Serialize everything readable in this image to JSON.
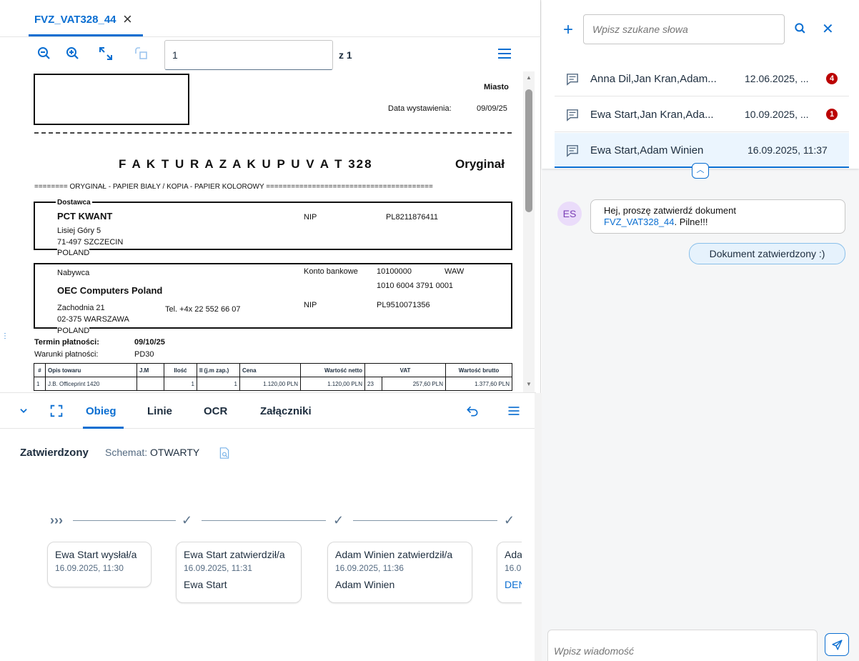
{
  "tab": {
    "title": "FVZ_VAT328_44",
    "close": "×"
  },
  "toolbar": {
    "page_value": "1",
    "page_of": "z 1"
  },
  "invoice": {
    "miasto": "Miasto",
    "data_label": "Data wystawienia:",
    "data_value": "09/09/25",
    "title": "F A K T U R A  Z A K U P U  V A T 328",
    "original": "Oryginał",
    "copy_line": "======== ORYGINAŁ - PAPIER BIAŁY / KOPIA - PAPIER KOLOROWY ========================================",
    "supplier_label": "Dostawca",
    "supplier_name": "PCT  KWANT",
    "supplier_addr1": "Lisiej Góry 5",
    "supplier_addr2": "71-497 SZCZECIN",
    "supplier_country": "POLAND",
    "nip_label": "NIP",
    "supplier_nip": "PL8211876411",
    "buyer_label": "Nabywca",
    "buyer_name": "OEC Computers Poland",
    "buyer_addr1": "Zachodnia 21",
    "buyer_addr2": "02-375 WARSZAWA",
    "buyer_country": "POLAND",
    "buyer_tel": "Tel.  +4x 22 552 66 07",
    "bank_label": "Konto bankowe",
    "bank_value1": "10100000",
    "bank_city": "WAW",
    "bank_value2": "1010 6004 3791 0001",
    "buyer_nip": "PL9510071356",
    "term_label": "Termin płatności:",
    "term_value": "09/10/25",
    "cond_label": "Warunki płatności:",
    "cond_value": "PD30",
    "table_headers": [
      "#",
      "Opis towaru",
      "J.M",
      "Ilość",
      "Il (j.m zap.)",
      "Cena",
      "Wartość netto",
      "VAT",
      "Wartość brutto"
    ],
    "row1": [
      "1",
      "J.B. Officeprint 1420",
      "",
      "1",
      "1",
      "1.120,00 PLN",
      "1.120,00 PLN",
      "23",
      "257,60 PLN",
      "1.377,60 PLN"
    ]
  },
  "bottom_tabs": {
    "obieg": "Obieg",
    "linie": "Linie",
    "ocr": "OCR",
    "zalaczniki": "Załączniki"
  },
  "workflow": {
    "status": "Zatwierdzony",
    "schema_label": "Schemat:",
    "schema_value": "OTWARTY",
    "steps": [
      {
        "title": "Ewa Start wysłał/a",
        "date": "16.09.2025, 11:30",
        "user": ""
      },
      {
        "title": "Ewa Start zatwierdził/a",
        "date": "16.09.2025, 11:31",
        "user": "Ewa Start"
      },
      {
        "title": "Adam Winien zatwierdził/a",
        "date": "16.09.2025, 11:36",
        "user": "Adam Winien"
      },
      {
        "title": "Ada",
        "date": "16.0",
        "user": "DEN"
      }
    ]
  },
  "search": {
    "placeholder": "Wpisz szukane słowa"
  },
  "conversations": [
    {
      "names": "Anna Dil,Jan Kran,Adam...",
      "date": "12.06.2025, ...",
      "badge": "4"
    },
    {
      "names": "Ewa Start,Jan Kran,Ada...",
      "date": "10.09.2025, ...",
      "badge": "1"
    },
    {
      "names": "Ewa Start,Adam Winien",
      "date": "16.09.2025, 11:37",
      "badge": ""
    }
  ],
  "chat": {
    "avatar": "ES",
    "msg_line1": "Hej, proszę zatwierdź dokument",
    "msg_link": "FVZ_VAT328_44",
    "msg_rest": ". Pilne!!!",
    "reply": "Dokument zatwierdzony :)",
    "compose_placeholder": "Wpisz wiadomość"
  },
  "colors": {
    "accent": "#0a6ed1",
    "badge": "#bb0000"
  }
}
